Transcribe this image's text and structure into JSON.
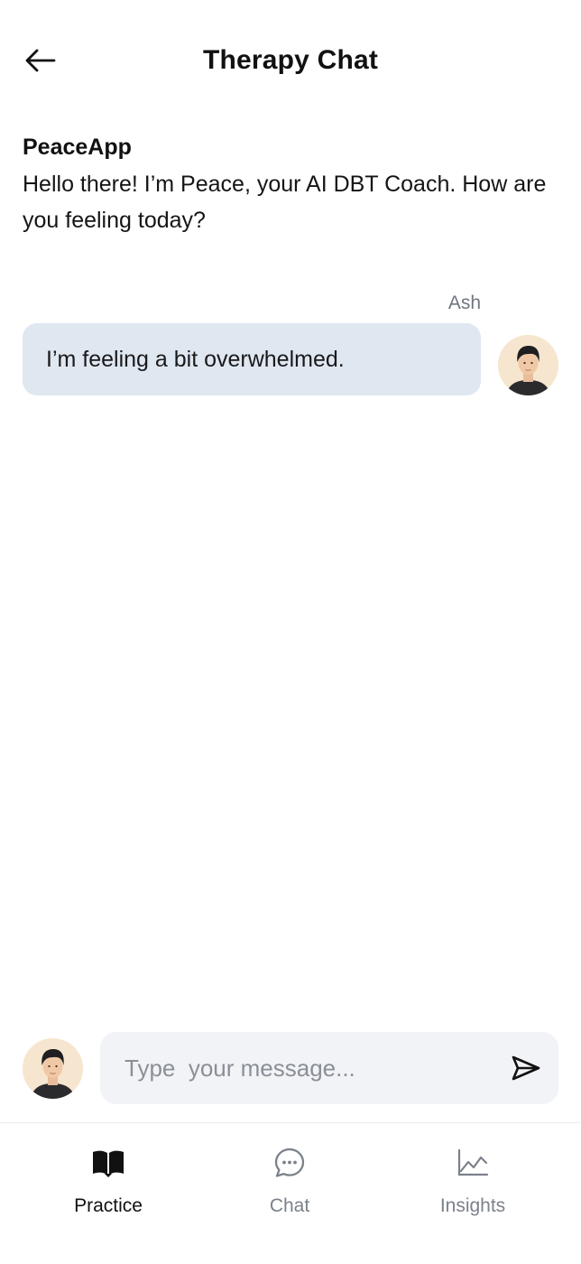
{
  "header": {
    "title": "Therapy Chat",
    "back_icon": "arrow-left-icon"
  },
  "messages": [
    {
      "sender": "PeaceApp",
      "text": "Hello there! I’m Peace, your AI DBT Coach. How are you feeling today?"
    },
    {
      "sender": "Ash",
      "text": "I’m feeling a bit overwhelmed."
    }
  ],
  "composer": {
    "placeholder": "Type  your message...",
    "value": "",
    "send_icon": "send-icon"
  },
  "nav": {
    "items": [
      {
        "label": "Practice",
        "icon": "book-icon",
        "active": true
      },
      {
        "label": "Chat",
        "icon": "chat-bubble-icon",
        "active": false
      },
      {
        "label": "Insights",
        "icon": "line-chart-icon",
        "active": false
      }
    ]
  },
  "colors": {
    "user_bubble": "#dfe7f1",
    "composer_bg": "#f2f3f6",
    "avatar_bg": "#f7e6cf",
    "nav_active": "#111111",
    "nav_inactive": "#7b818a"
  }
}
